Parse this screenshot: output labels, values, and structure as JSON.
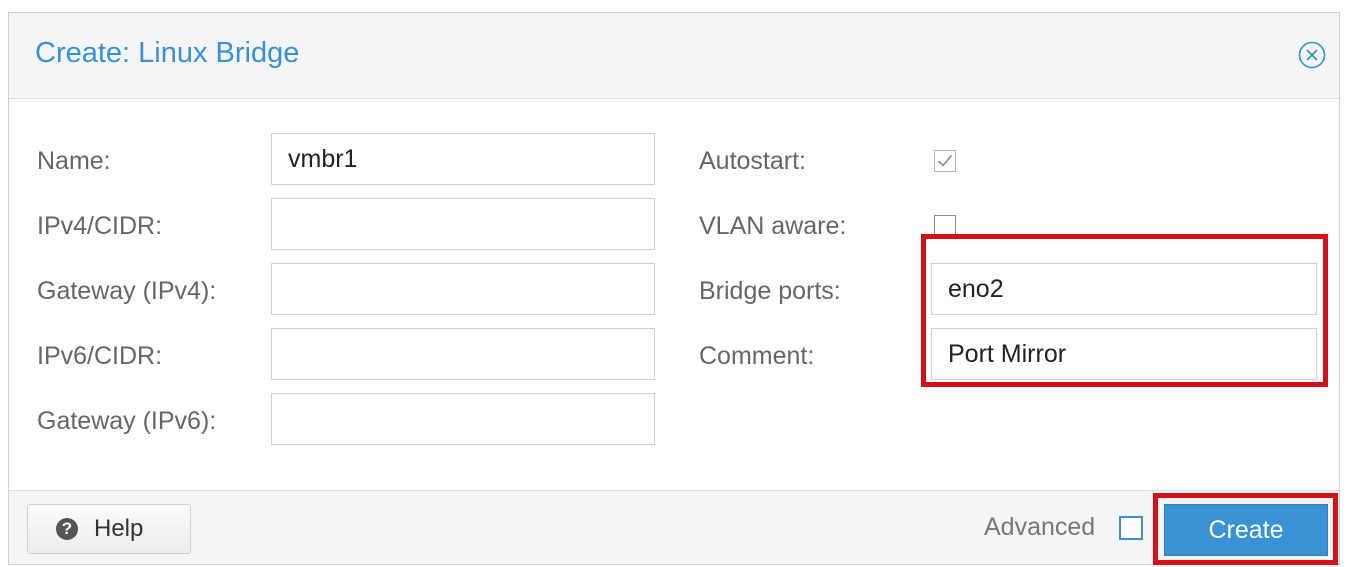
{
  "dialog": {
    "title": "Create: Linux Bridge",
    "close_icon": "close-circle-icon"
  },
  "left_fields": [
    {
      "label": "Name:",
      "value": "vmbr1"
    },
    {
      "label": "IPv4/CIDR:",
      "value": ""
    },
    {
      "label": "Gateway (IPv4):",
      "value": ""
    },
    {
      "label": "IPv6/CIDR:",
      "value": ""
    },
    {
      "label": "Gateway (IPv6):",
      "value": ""
    }
  ],
  "right_fields": {
    "autostart": {
      "label": "Autostart:",
      "checked": true
    },
    "vlan_aware": {
      "label": "VLAN aware:",
      "checked": false
    },
    "bridge_ports": {
      "label": "Bridge ports:",
      "value": "eno2"
    },
    "comment": {
      "label": "Comment:",
      "value": "Port Mirror"
    }
  },
  "footer": {
    "help_label": "Help",
    "help_icon": "question-circle-icon",
    "advanced_label": "Advanced",
    "advanced_checked": false,
    "create_label": "Create"
  },
  "colors": {
    "accent": "#3892d4",
    "highlight": "#d4111a"
  }
}
